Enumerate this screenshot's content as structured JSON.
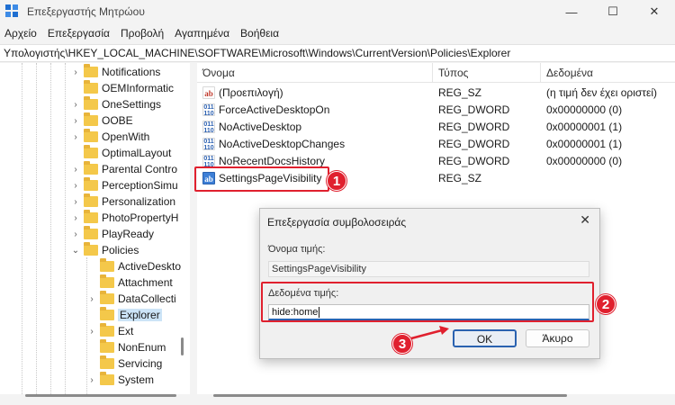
{
  "window": {
    "title": "Επεξεργαστής Μητρώου",
    "controls": {
      "minimize": "—",
      "maximize": "☐",
      "close": "✕"
    }
  },
  "menu": [
    "Αρχείο",
    "Επεξεργασία",
    "Προβολή",
    "Αγαπημένα",
    "Βοήθεια"
  ],
  "address": "Υπολογιστής\\HKEY_LOCAL_MACHINE\\SOFTWARE\\Microsoft\\Windows\\CurrentVersion\\Policies\\Explorer",
  "tree": {
    "items": [
      {
        "label": "Notifications",
        "chevron": "›",
        "level": 0
      },
      {
        "label": "OEMInformatic",
        "chevron": "",
        "level": 0
      },
      {
        "label": "OneSettings",
        "chevron": "›",
        "level": 0
      },
      {
        "label": "OOBE",
        "chevron": "›",
        "level": 0
      },
      {
        "label": "OpenWith",
        "chevron": "›",
        "level": 0
      },
      {
        "label": "OptimalLayout",
        "chevron": "",
        "level": 0
      },
      {
        "label": "Parental Contro",
        "chevron": "›",
        "level": 0
      },
      {
        "label": "PerceptionSimu",
        "chevron": "›",
        "level": 0
      },
      {
        "label": "Personalization",
        "chevron": "›",
        "level": 0
      },
      {
        "label": "PhotoPropertyH",
        "chevron": "›",
        "level": 0
      },
      {
        "label": "PlayReady",
        "chevron": "›",
        "level": 0
      },
      {
        "label": "Policies",
        "chevron": "⌄",
        "level": 0
      },
      {
        "label": "ActiveDeskto",
        "chevron": "",
        "level": 1
      },
      {
        "label": "Attachment",
        "chevron": "",
        "level": 1
      },
      {
        "label": "DataCollecti",
        "chevron": "›",
        "level": 1
      },
      {
        "label": "Explorer",
        "chevron": "",
        "level": 1,
        "selected": true
      },
      {
        "label": "Ext",
        "chevron": "›",
        "level": 1
      },
      {
        "label": "NonEnum",
        "chevron": "",
        "level": 1
      },
      {
        "label": "Servicing",
        "chevron": "",
        "level": 1
      },
      {
        "label": "System",
        "chevron": "›",
        "level": 1
      }
    ]
  },
  "list": {
    "columns": [
      "Όνομα",
      "Τύπος",
      "Δεδομένα"
    ],
    "rows": [
      {
        "name": "(Προεπιλογή)",
        "type": "REG_SZ",
        "data": "(η τιμή δεν έχει οριστεί)",
        "icon": "string-value-icon"
      },
      {
        "name": "ForceActiveDesktopOn",
        "type": "REG_DWORD",
        "data": "0x00000000 (0)",
        "icon": "dword-value-icon"
      },
      {
        "name": "NoActiveDesktop",
        "type": "REG_DWORD",
        "data": "0x00000001 (1)",
        "icon": "dword-value-icon"
      },
      {
        "name": "NoActiveDesktopChanges",
        "type": "REG_DWORD",
        "data": "0x00000001 (1)",
        "icon": "dword-value-icon"
      },
      {
        "name": "NoRecentDocsHistory",
        "type": "REG_DWORD",
        "data": "0x00000000 (0)",
        "icon": "dword-value-icon"
      },
      {
        "name": "SettingsPageVisibility",
        "type": "REG_SZ",
        "data": "",
        "icon": "string-value-icon"
      }
    ]
  },
  "dialog": {
    "title": "Επεξεργασία συμβολοσειράς",
    "close": "✕",
    "name_label": "Όνομα τιμής:",
    "name_value": "SettingsPageVisibility",
    "data_label": "Δεδομένα τιμής:",
    "data_value": "hide:home",
    "ok": "OK",
    "cancel": "Άκυρο"
  },
  "badges": [
    "1",
    "2",
    "3"
  ],
  "accent_colors": {
    "highlight": "#e0202e",
    "selection": "#cce4f7",
    "focus": "#2a62b0"
  }
}
